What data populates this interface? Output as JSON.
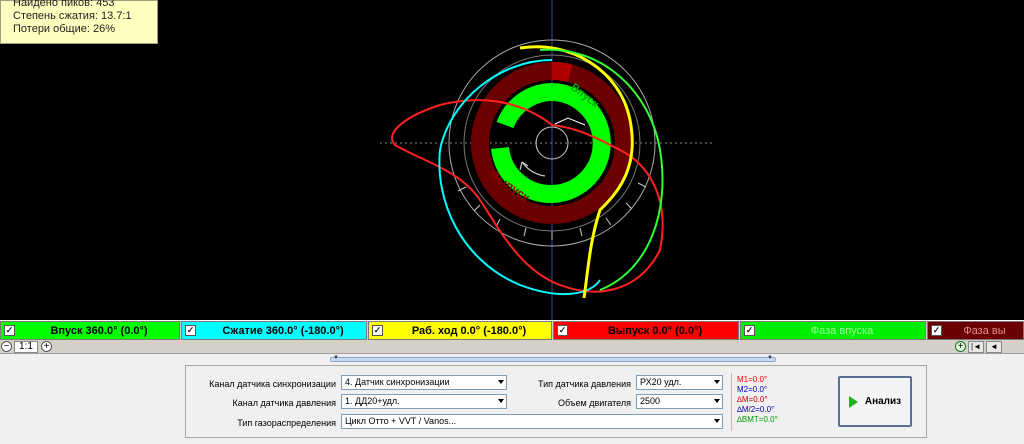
{
  "info": {
    "peaks": "Найдено пиков: 453",
    "compression": "Степень сжатия: 13.7:1",
    "losses": "Потери общие: 26%"
  },
  "diagram": {
    "intake_label": "Впуск",
    "exhaust_label": "Выпуск"
  },
  "phases": [
    {
      "label": "Впуск 360.0° (0.0°)",
      "bg": "#00ff00",
      "fg": "#000000"
    },
    {
      "label": "Сжатие 360.0° (-180.0°)",
      "bg": "#00ffff",
      "fg": "#000000"
    },
    {
      "label": "Раб. ход 0.0° (-180.0°)",
      "bg": "#ffff00",
      "fg": "#000000"
    },
    {
      "label": "Выпуск 0.0° (0.0°)",
      "bg": "#ff0000",
      "fg": "#000000"
    },
    {
      "label": "Фаза впуска",
      "bg": "#00ee00",
      "fg": "#a0ffa0"
    },
    {
      "label": "Фаза вы",
      "bg": "#6a0000",
      "fg": "#e09090"
    }
  ],
  "zoom": {
    "minus": "−",
    "plus": "+",
    "scale": "1:1",
    "plus_right": "+",
    "first": "|◄",
    "prev": "◄"
  },
  "settings": {
    "sync_channel_label": "Канал датчика синхронизации",
    "sync_channel_value": "4.  Датчик синхронизации",
    "pressure_channel_label": "Канал датчика давления",
    "pressure_channel_value": "1.  ДД20+удл.",
    "timing_type_label": "Тип газораспределения",
    "timing_type_value": "Цикл Отто + VVT / Vanos...",
    "sensor_type_label": "Тип датчика давления",
    "sensor_type_value": "РХ20 удл.",
    "engine_volume_label": "Объем двигателя",
    "engine_volume_value": "2500"
  },
  "markers": {
    "m1": "M1=0.0°",
    "m2": "M2=0.0°",
    "dm": "∆M=0.0°",
    "dm2": "∆M/2=0.0°",
    "bmt": "∆ВМТ=0.0°",
    "colors": {
      "m1": "#ff0000",
      "m2": "#0000cc",
      "dm": "#cc0000",
      "dm2": "#0000aa",
      "bmt": "#00a000"
    }
  },
  "analyze_button": "Анализ"
}
